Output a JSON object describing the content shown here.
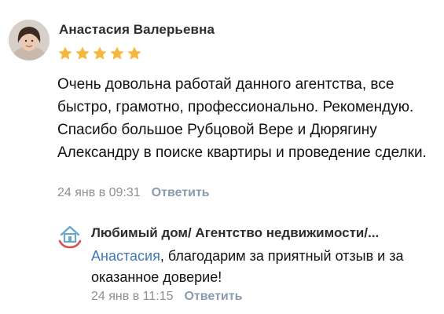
{
  "comment": {
    "author": "Анастасия Валерьевна",
    "rating": 5,
    "text": "Очень довольна работай данного агентства, все быстро, грамотно, профессионально. Рекомендую. Спасибо большое Рубцовой Вере и Дюрягину Александру в поиске квартиры и проведение сделки.",
    "date": "24 янв в 09:31",
    "reply_label": "Ответить",
    "avatar_icon": "user-avatar-photo"
  },
  "reply": {
    "author": "Любимый дом/ Агентство недвижимости/...",
    "mention": "Анастасия",
    "text": ", благодарим за приятный отзыв и за оказанное доверие!",
    "date": "24 янв в 11:15",
    "reply_label": "Ответить",
    "logo_icon": "house-hands-logo"
  },
  "colors": {
    "star": "#f5b83d",
    "link": "#8a9bb0",
    "mention": "#3f78b3",
    "meta": "#8c8f94",
    "logo_house": "#6aa7c8",
    "logo_hands": "#d9534f"
  }
}
